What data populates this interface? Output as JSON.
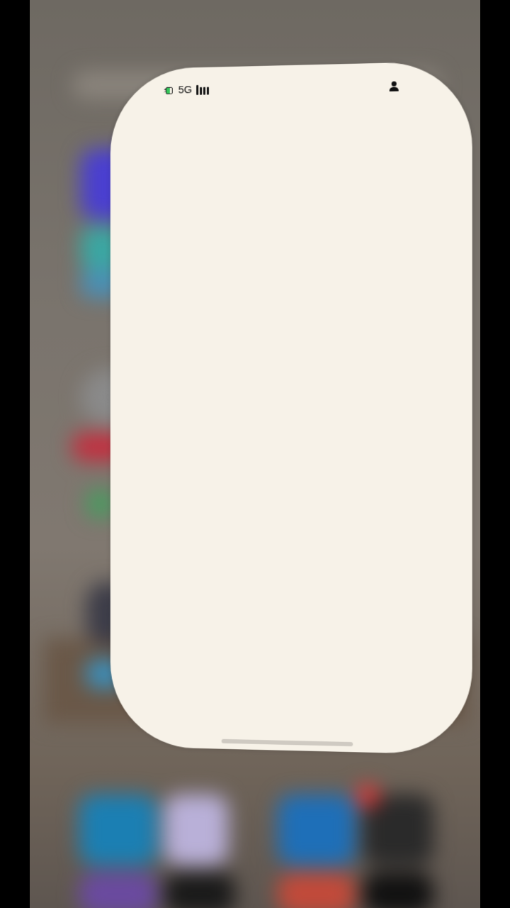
{
  "status_bar": {
    "network_label": "5G",
    "battery_icon": "battery-charging-icon",
    "signal_icon": "signal-bars-icon",
    "person_icon": "person-icon"
  },
  "colors": {
    "card_background": "#f7f2e8",
    "backdrop": "#7a746d",
    "battery_fill": "#34c759"
  }
}
